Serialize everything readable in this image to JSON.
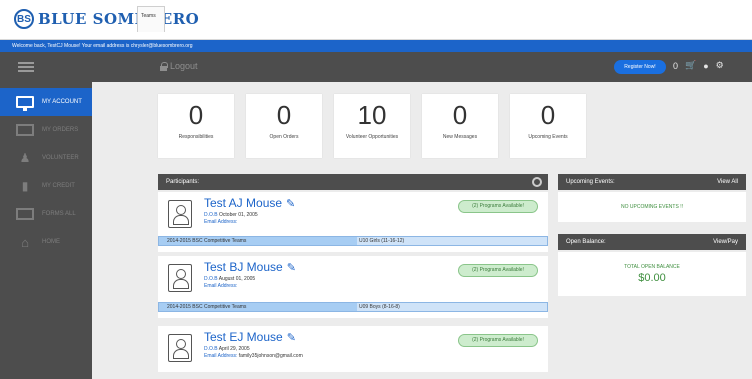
{
  "app": {
    "logo_text": "BLUE SOMBRERO",
    "logo_mark": "BS",
    "tab_label": "Teams"
  },
  "welcome": {
    "text": "Welcome back, TestCJ Mouse! Your email address is chrysler@bluesombrero.org"
  },
  "header": {
    "logout_label": "Logout",
    "register_label": "Register Now!",
    "cart_count": "0"
  },
  "sidebar": {
    "items": [
      {
        "label": "MY ACCOUNT",
        "icon": "monitor-icon"
      },
      {
        "label": "MY ORDERS",
        "icon": "box-icon"
      },
      {
        "label": "VOLUNTEER",
        "icon": "person-icon"
      },
      {
        "label": "MY CREDIT",
        "icon": "bottle-icon"
      },
      {
        "label": "FORMS ALL",
        "icon": "card-icon"
      },
      {
        "label": "HOME",
        "icon": "home-icon"
      }
    ]
  },
  "stats": [
    {
      "value": "0",
      "label": "Responsibilities"
    },
    {
      "value": "0",
      "label": "Open Orders"
    },
    {
      "value": "10",
      "label": "Volunteer Opportunities"
    },
    {
      "value": "0",
      "label": "New Messages"
    },
    {
      "value": "0",
      "label": "Upcoming Events"
    }
  ],
  "participants_panel": {
    "title": "Participants:"
  },
  "participants": [
    {
      "name": "Test AJ Mouse",
      "dob_key": "D.O.B",
      "dob": "October 01, 2005",
      "email_key": "Email Address:",
      "email": "",
      "badge": "(2) Programs Available!",
      "team_left": "2014-2015 BSC Competitive Teams",
      "team_right": "U10 Girls (11-16-12)"
    },
    {
      "name": "Test BJ Mouse",
      "dob_key": "D.O.B",
      "dob": "August 01, 2005",
      "email_key": "Email Address:",
      "email": "",
      "badge": "(2) Programs Available!",
      "team_left": "2014-2015 BSC Competitive Teams",
      "team_right": "U09 Boys (8-16-8)"
    },
    {
      "name": "Test EJ Mouse",
      "dob_key": "D.O.B",
      "dob": "April 29, 2005",
      "email_key": "Email Address:",
      "email": "family35johnson@gmail.com",
      "badge": "(2) Programs Available!",
      "team_left": "",
      "team_right": ""
    }
  ],
  "upcoming_events": {
    "title": "Upcoming Events:",
    "action": "View All",
    "empty_text": "NO UPCOMING EVENTS !!"
  },
  "open_balance": {
    "title": "Open Balance:",
    "action": "View/Pay",
    "label": "TOTAL OPEN BALANCE",
    "amount": "$0.00"
  }
}
